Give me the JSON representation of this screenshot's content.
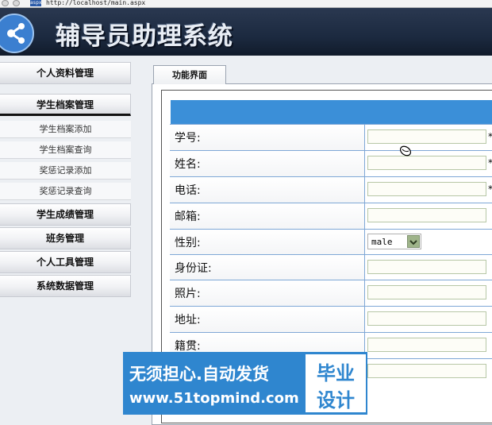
{
  "browser": {
    "url": "http://localhost/main.aspx",
    "favicon_text": "aspx"
  },
  "header": {
    "title": "辅导员助理系统"
  },
  "sidebar": {
    "menus": [
      {
        "label": "个人资料管理"
      },
      {
        "label": "学生档案管理",
        "active": true
      },
      {
        "label": "学生成绩管理"
      },
      {
        "label": "班务管理"
      },
      {
        "label": "个人工具管理"
      },
      {
        "label": "系统数据管理"
      }
    ],
    "subitems": [
      {
        "label": "学生档案添加"
      },
      {
        "label": "学生档案查询"
      },
      {
        "label": "奖惩记录添加"
      },
      {
        "label": "奖惩记录查询"
      }
    ]
  },
  "main": {
    "tab_label": "功能界面",
    "form": {
      "header_color": "#3b8fd8",
      "rows": [
        {
          "label": "学号:",
          "value": "",
          "required_mark": "*"
        },
        {
          "label": "姓名:",
          "value": "",
          "required_mark": "*"
        },
        {
          "label": "电话:",
          "value": "",
          "required_mark": "*"
        },
        {
          "label": "邮箱:",
          "value": ""
        },
        {
          "label": "性别:",
          "type": "select",
          "selected": "male"
        },
        {
          "label": "身份证:",
          "value": ""
        },
        {
          "label": "照片:",
          "value": ""
        },
        {
          "label": "地址:",
          "value": ""
        },
        {
          "label": "籍贯:",
          "value": ""
        },
        {
          "label": "",
          "value": ""
        }
      ]
    }
  },
  "watermark": {
    "line1": "无须担心.自动发货",
    "line2": "www.51topmind.com",
    "badge_line1": "毕业",
    "badge_line2": "设计",
    "color": "#2f86cf"
  }
}
